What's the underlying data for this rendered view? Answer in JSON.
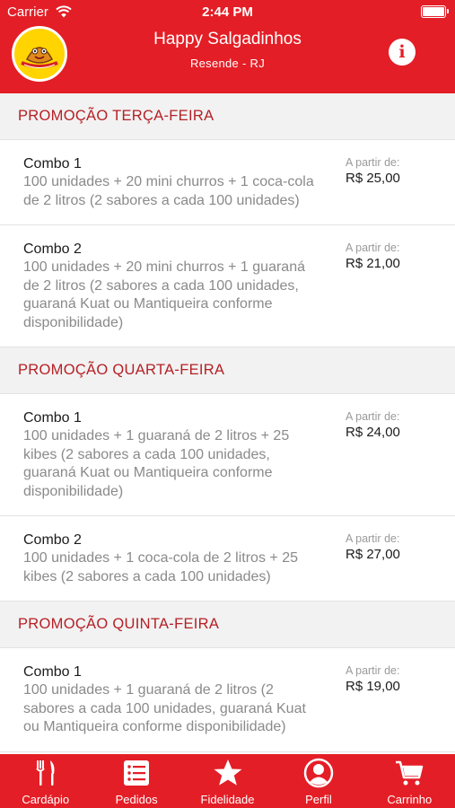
{
  "status_bar": {
    "carrier": "Carrier",
    "time": "2:44 PM"
  },
  "header": {
    "title": "Happy Salgadinhos",
    "subtitle": "Resende - RJ",
    "info_icon": "info-icon",
    "logo_text": "Happy Salgadinhos"
  },
  "sections": [
    {
      "title": "PROMOÇÃO TERÇA-FEIRA",
      "items": [
        {
          "name": "Combo 1",
          "desc": "100 unidades + 20 mini churros + 1 coca-cola de 2 litros (2 sabores a cada 100 unidades)",
          "price_label": "A partir de:",
          "price": "R$ 25,00"
        },
        {
          "name": "Combo 2",
          "desc": "100 unidades + 20 mini churros + 1 guaraná de 2 litros (2 sabores a cada 100 unidades, guaraná Kuat ou Mantiqueira conforme disponibilidade)",
          "price_label": "A partir de:",
          "price": "R$ 21,00"
        }
      ]
    },
    {
      "title": "PROMOÇÃO QUARTA-FEIRA",
      "items": [
        {
          "name": "Combo 1",
          "desc": "100 unidades + 1 guaraná de 2 litros + 25 kibes (2 sabores a cada 100 unidades, guaraná Kuat ou Mantiqueira conforme disponibilidade)",
          "price_label": "A partir de:",
          "price": "R$ 24,00"
        },
        {
          "name": "Combo 2",
          "desc": "100 unidades + 1 coca-cola de 2 litros + 25 kibes (2 sabores a cada 100 unidades)",
          "price_label": "A partir de:",
          "price": "R$ 27,00"
        }
      ]
    },
    {
      "title": "PROMOÇÃO QUINTA-FEIRA",
      "items": [
        {
          "name": "Combo 1",
          "desc": "100 unidades + 1 guaraná de 2 litros (2 sabores a cada 100 unidades, guaraná Kuat ou Mantiqueira conforme disponibilidade)",
          "price_label": "A partir de:",
          "price": "R$ 19,00"
        }
      ]
    }
  ],
  "tabbar": {
    "tabs": [
      {
        "label": "Cardápio",
        "icon": "fork-knife-icon"
      },
      {
        "label": "Pedidos",
        "icon": "list-icon"
      },
      {
        "label": "Fidelidade",
        "icon": "star-icon"
      },
      {
        "label": "Perfil",
        "icon": "user-icon"
      },
      {
        "label": "Carrinho",
        "icon": "cart-icon"
      }
    ]
  },
  "colors": {
    "brand_red": "#e41e26",
    "section_text": "#b52025",
    "section_bg": "#f2f2f2",
    "logo_yellow": "#ffd400"
  }
}
